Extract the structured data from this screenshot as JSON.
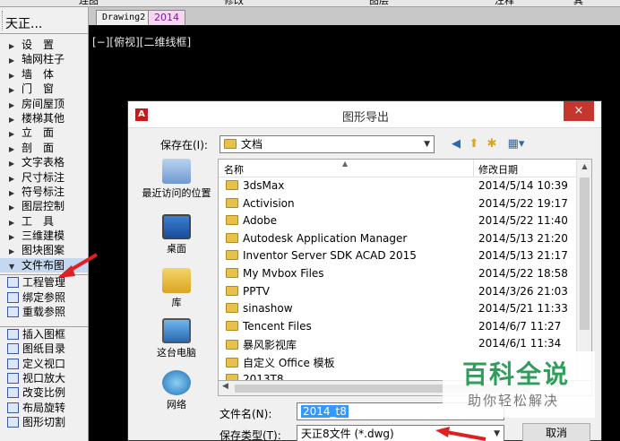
{
  "top_menu": [
    "连图",
    "修改",
    "图层",
    "注释",
    "其"
  ],
  "panel": {
    "title": "天正...",
    "menu": [
      "设　置",
      "轴网柱子",
      "墙　体",
      "门　窗",
      "房间屋顶",
      "楼梯其他",
      "立　面",
      "剖　面",
      "文字表格",
      "尺寸标注",
      "符号标注",
      "图层控制",
      "工　具",
      "三维建模",
      "图块图案",
      "文件布图"
    ],
    "active_index": 15,
    "sub_group1": [
      "工程管理",
      "绑定参照",
      "重载参照"
    ],
    "sub_group2": [
      "插入图框",
      "图纸目录",
      "定义视口",
      "视口放大",
      "改变比例",
      "布局旋转",
      "图形切割"
    ]
  },
  "tabs": [
    "Drawing2",
    "2014"
  ],
  "viewport_label": "[−][俯视][二维线框]",
  "dialog": {
    "title": "图形导出",
    "close": "×",
    "save_in_label": "保存在(I):",
    "save_in_value": "文档",
    "places": [
      "最近访问的位置",
      "桌面",
      "库",
      "这台电脑",
      "网络"
    ],
    "columns": {
      "name": "名称",
      "date": "修改日期"
    },
    "files": [
      {
        "name": "3dsMax",
        "date": "2014/5/14 10:39"
      },
      {
        "name": "Activision",
        "date": "2014/5/22 19:17"
      },
      {
        "name": "Adobe",
        "date": "2014/5/22 11:40"
      },
      {
        "name": "Autodesk Application Manager",
        "date": "2014/5/13 21:20"
      },
      {
        "name": "Inventor Server SDK ACAD 2015",
        "date": "2014/5/13 21:17"
      },
      {
        "name": "My Mvbox Files",
        "date": "2014/5/22 18:58"
      },
      {
        "name": "PPTV",
        "date": "2014/3/26 21:03"
      },
      {
        "name": "sinashow",
        "date": "2014/5/21 11:33"
      },
      {
        "name": "Tencent Files",
        "date": "2014/6/7 11:27"
      },
      {
        "name": "暴风影视库",
        "date": "2014/6/1 11:34"
      },
      {
        "name": "自定义 Office 模板",
        "date": ""
      },
      {
        "name": "2013T8",
        "date": ""
      }
    ],
    "filename_label": "文件名(N):",
    "filename_value": "2014_t8",
    "filetype_label": "保存类型(T):",
    "filetype_value": "天正8文件 (*.dwg)",
    "cancel": "取消"
  },
  "watermark": {
    "big": "百科全说",
    "small": "助你轻松解决"
  },
  "colors": {
    "accent_red": "#e02020",
    "watermark_green": "#2f9e5a"
  }
}
